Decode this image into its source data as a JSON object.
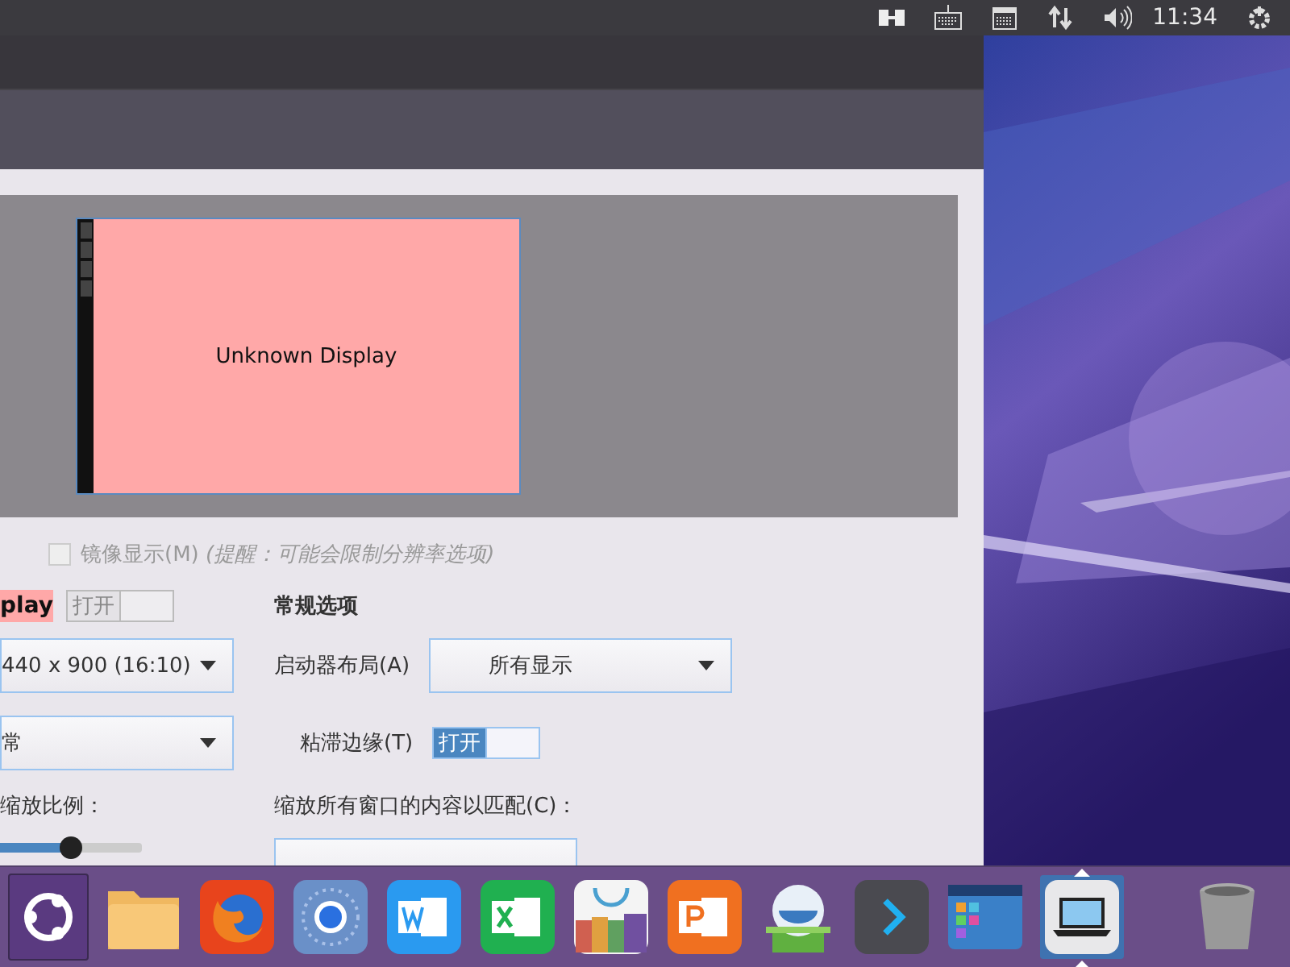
{
  "panel": {
    "time": "11:34"
  },
  "display_preview": {
    "monitor_label": "Unknown Display"
  },
  "mirror": {
    "checked": false,
    "disabled": true,
    "label": "镜像显示(M) *(提醒：可能会限制分辨率选项)*"
  },
  "display_settings": {
    "name": "play",
    "toggle": {
      "label": "打开",
      "on": false
    },
    "resolution": "440 x 900 (16:10)",
    "rotation": "常",
    "scale_label": "缩放比例：",
    "scale_slider": {
      "level": 0.5
    }
  },
  "general": {
    "title": "常规选项",
    "launcher_label": "启动器布局(A)",
    "launcher_value": "所有显示",
    "sticky_label": "粘滞边缘(T)",
    "sticky_toggle": {
      "label": "打开",
      "on": true
    },
    "scale_all_label": "缩放所有窗口的内容以匹配(C)："
  },
  "dock": [
    {
      "kind": "ubuntu",
      "selected": false
    },
    {
      "kind": "folder",
      "selected": false
    },
    {
      "kind": "firefox",
      "selected": false
    },
    {
      "kind": "chromium",
      "selected": false
    },
    {
      "kind": "word",
      "selected": false
    },
    {
      "kind": "excel",
      "selected": false
    },
    {
      "kind": "store",
      "selected": false
    },
    {
      "kind": "powerpoint",
      "selected": false
    },
    {
      "kind": "robot",
      "selected": false
    },
    {
      "kind": "arrow",
      "selected": false
    },
    {
      "kind": "windows",
      "selected": false
    },
    {
      "kind": "laptop",
      "selected": true
    },
    {
      "kind": "trash",
      "selected": false
    }
  ]
}
